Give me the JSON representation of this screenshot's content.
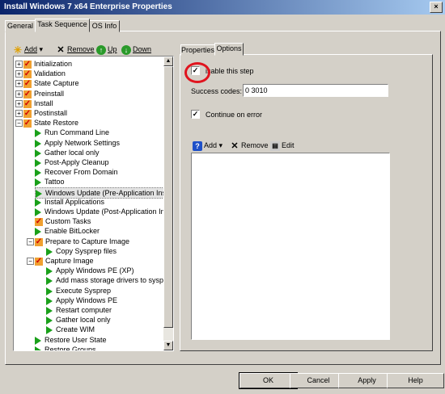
{
  "window": {
    "title": "Install Windows 7 x64 Enterprise Properties",
    "close_glyph": "×"
  },
  "main_tabs": [
    {
      "label": "General"
    },
    {
      "label": "Task Sequence"
    },
    {
      "label": "OS Info"
    }
  ],
  "toolbar": {
    "add": "Add",
    "remove": "Remove",
    "up": "Up",
    "down": "Down"
  },
  "tree": [
    {
      "label": "Initialization",
      "kind": "group",
      "expand": "+"
    },
    {
      "label": "Validation",
      "kind": "group",
      "expand": "+"
    },
    {
      "label": "State Capture",
      "kind": "group",
      "expand": "+"
    },
    {
      "label": "Preinstall",
      "kind": "group",
      "expand": "+"
    },
    {
      "label": "Install",
      "kind": "group",
      "expand": "+"
    },
    {
      "label": "Postinstall",
      "kind": "group",
      "expand": "+"
    },
    {
      "label": "State Restore",
      "kind": "group",
      "expand": "−"
    },
    {
      "label": "Run Command Line",
      "kind": "step"
    },
    {
      "label": "Apply Network Settings",
      "kind": "step"
    },
    {
      "label": "Gather local only",
      "kind": "step"
    },
    {
      "label": "Post-Apply Cleanup",
      "kind": "step"
    },
    {
      "label": "Recover From Domain",
      "kind": "step"
    },
    {
      "label": "Tattoo",
      "kind": "step"
    },
    {
      "label": "Windows Update (Pre-Application Inst",
      "kind": "step",
      "selected": true
    },
    {
      "label": "Install Applications",
      "kind": "step"
    },
    {
      "label": "Windows Update (Post-Application Ins",
      "kind": "step"
    },
    {
      "label": "Custom Tasks",
      "kind": "group"
    },
    {
      "label": "Enable BitLocker",
      "kind": "step"
    },
    {
      "label": "Prepare to Capture Image",
      "kind": "group",
      "expand": "−"
    },
    {
      "label": "Copy Sysprep files",
      "kind": "step"
    },
    {
      "label": "Capture Image",
      "kind": "group",
      "expand": "−"
    },
    {
      "label": "Apply Windows PE (XP)",
      "kind": "step"
    },
    {
      "label": "Add mass storage drivers to syspre",
      "kind": "step"
    },
    {
      "label": "Execute Sysprep",
      "kind": "step"
    },
    {
      "label": "Apply Windows PE",
      "kind": "step"
    },
    {
      "label": "Restart computer",
      "kind": "step"
    },
    {
      "label": "Gather local only",
      "kind": "step"
    },
    {
      "label": "Create WIM",
      "kind": "step"
    },
    {
      "label": "Restore User State",
      "kind": "step"
    },
    {
      "label": "Restore Groups",
      "kind": "step"
    }
  ],
  "right_tabs": [
    {
      "label": "Properties"
    },
    {
      "label": "Options"
    }
  ],
  "options": {
    "disable_label": "isable this step",
    "disable_checked": true,
    "success_codes_label": "Success codes:",
    "success_codes_value": "0 3010",
    "continue_label": "Continue on error",
    "continue_checked": true
  },
  "subtoolbar": {
    "add": "Add",
    "remove": "Remove",
    "edit": "Edit"
  },
  "buttons": {
    "ok": "OK",
    "cancel": "Cancel",
    "apply": "Apply",
    "help": "Help"
  }
}
